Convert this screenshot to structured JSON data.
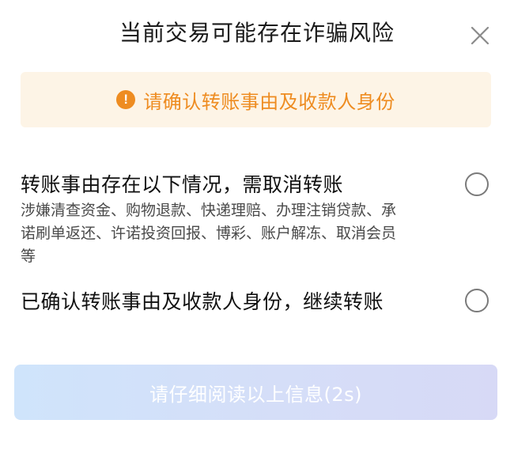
{
  "dialog": {
    "title": "当前交易可能存在诈骗风险",
    "close_icon": "close-icon"
  },
  "alert": {
    "icon": "exclamation-circle-icon",
    "icon_glyph": "!",
    "text": "请确认转账事由及收款人身份",
    "background_color": "#fdf4e6",
    "accent_color": "#ee8c21"
  },
  "options": [
    {
      "title": "转账事由存在以下情况，需取消转账",
      "description": "涉嫌清查资金、购物退款、快递理赔、办理注销贷款、承诺刷单返还、许诺投资回报、博彩、账户解冻、取消会员等",
      "selected": false
    },
    {
      "title": "已确认转账事由及收款人身份，继续转账",
      "selected": false
    }
  ],
  "continue_button": {
    "label": "请仔细阅读以上信息(2s)",
    "enabled": false,
    "countdown_seconds": 2
  }
}
